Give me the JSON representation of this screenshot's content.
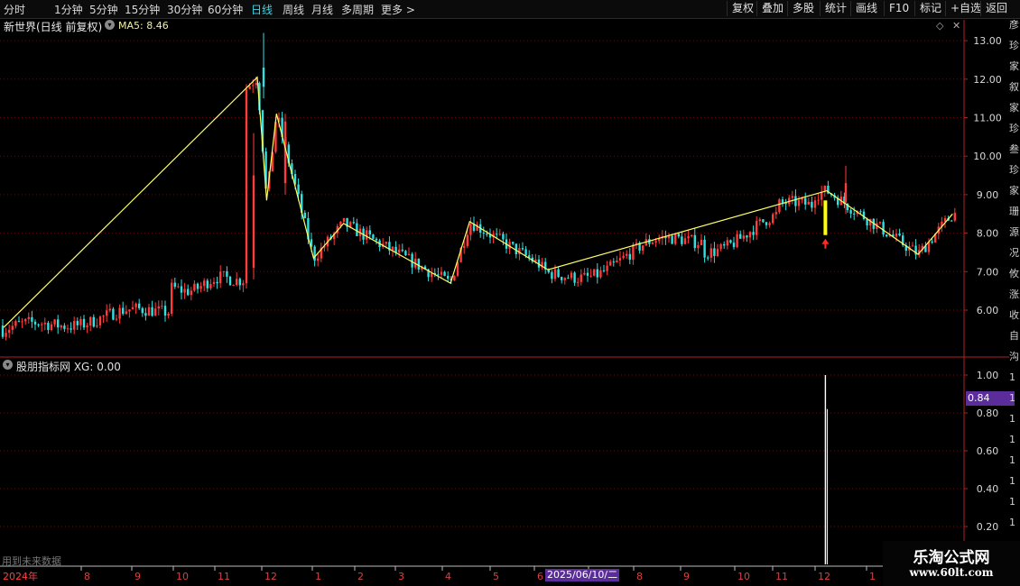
{
  "toolbar": {
    "periods": [
      "分时",
      "1分钟",
      "5分钟",
      "15分钟",
      "30分钟",
      "60分钟",
      "日线",
      "周线",
      "月线",
      "多周期",
      "更多 >"
    ],
    "active_period": "日线",
    "tools": [
      "复权",
      "叠加",
      "多股",
      "统计",
      "画线",
      "F10",
      "标记",
      "+自选",
      "返回"
    ]
  },
  "main_header": {
    "stock": "新世界(日线 前复权)",
    "indicator": "MA5: 8.46"
  },
  "sub_header": {
    "indicator": "股朋指标网 XG: 0.00"
  },
  "crosshair_value": "0.84",
  "crosshair_date": "2025/06/10/二",
  "future_data_note": "用到未来数据",
  "watermark": {
    "name": "乐淘公式网",
    "url": "www.60lt.com"
  },
  "right_strip_chars": [
    "彦",
    "珍",
    "家",
    "叙",
    "家",
    "珍",
    "叁",
    "珍",
    "家",
    "珊",
    "源",
    "况",
    "攸",
    "涨",
    "收",
    "自",
    "沟",
    "1",
    "1",
    "1",
    "1",
    "1",
    "1",
    "1",
    "1"
  ],
  "colors": {
    "up": "#ff3b3b",
    "down": "#32e0e0",
    "zigzag": "#ffff66",
    "axis": "#b02020",
    "grid": "#5a1010",
    "signal": "#ffffff"
  },
  "chart_data": [
    {
      "type": "candlestick",
      "title": "新世界(日线 前复权)",
      "x_ticks": [
        "2024年",
        "8",
        "9",
        "10",
        "11",
        "12",
        "1",
        "2",
        "3",
        "4",
        "5",
        "6",
        "7",
        "8",
        "9",
        "10",
        "11",
        "12",
        "1"
      ],
      "y_ticks": [
        6.0,
        7.0,
        8.0,
        9.0,
        10.0,
        11.0,
        12.0,
        13.0
      ],
      "ylim": [
        5.0,
        13.3
      ],
      "grid": true,
      "zigzag": [
        {
          "date": "2024-06-20",
          "price": 5.55
        },
        {
          "date": "2024-11-29",
          "price": 12.05
        },
        {
          "date": "2024-12-02",
          "price": 10.55
        },
        {
          "date": "2024-12-05",
          "price": 8.85
        },
        {
          "date": "2024-12-11",
          "price": 11.1
        },
        {
          "date": "2025-01-03",
          "price": 7.35
        },
        {
          "date": "2025-01-27",
          "price": 8.25
        },
        {
          "date": "2025-04-07",
          "price": 6.7
        },
        {
          "date": "2025-04-21",
          "price": 8.3
        },
        {
          "date": "2025-06-10",
          "price": 7.05
        },
        {
          "date": "2025-12-09",
          "price": 9.1
        },
        {
          "date": "2026-01-14",
          "price": 7.45
        },
        {
          "date": "2026-01-20",
          "price": 8.5
        }
      ],
      "signal_marker": {
        "date": "2025-12-08",
        "price": 7.95
      }
    },
    {
      "type": "bar",
      "title": "股朋指标网 XG: 0.00",
      "y_ticks": [
        0.2,
        0.4,
        0.6,
        0.8,
        1.0
      ],
      "ylim": [
        0,
        1.05
      ],
      "series": [
        {
          "name": "XG",
          "points": [
            {
              "date": "2025-12-08",
              "value": 1.0
            }
          ]
        }
      ]
    }
  ]
}
